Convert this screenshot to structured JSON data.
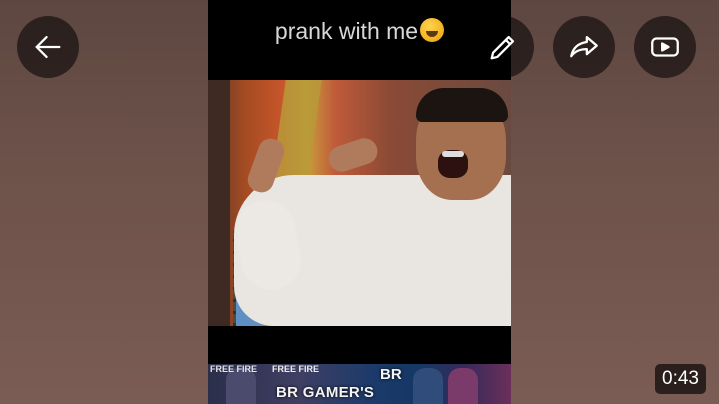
{
  "video": {
    "caption": "prank with me",
    "caption_emoji": "rolling-on-floor-laughing-emoji",
    "banner": {
      "brand_small_1": "FREE FIRE",
      "brand_small_2": "FREE FIRE",
      "channel": "BR GAMER'S",
      "channel_short": "BR"
    },
    "duration": "0:43"
  },
  "controls": {
    "back_icon": "arrow-left-icon",
    "edit_icon": "pencil-icon",
    "share_icon": "share-arrow-icon",
    "youtube_icon": "youtube-play-icon"
  },
  "colors": {
    "background": "#6e534b",
    "button_bg": "#000000",
    "icon": "#ffffff"
  }
}
